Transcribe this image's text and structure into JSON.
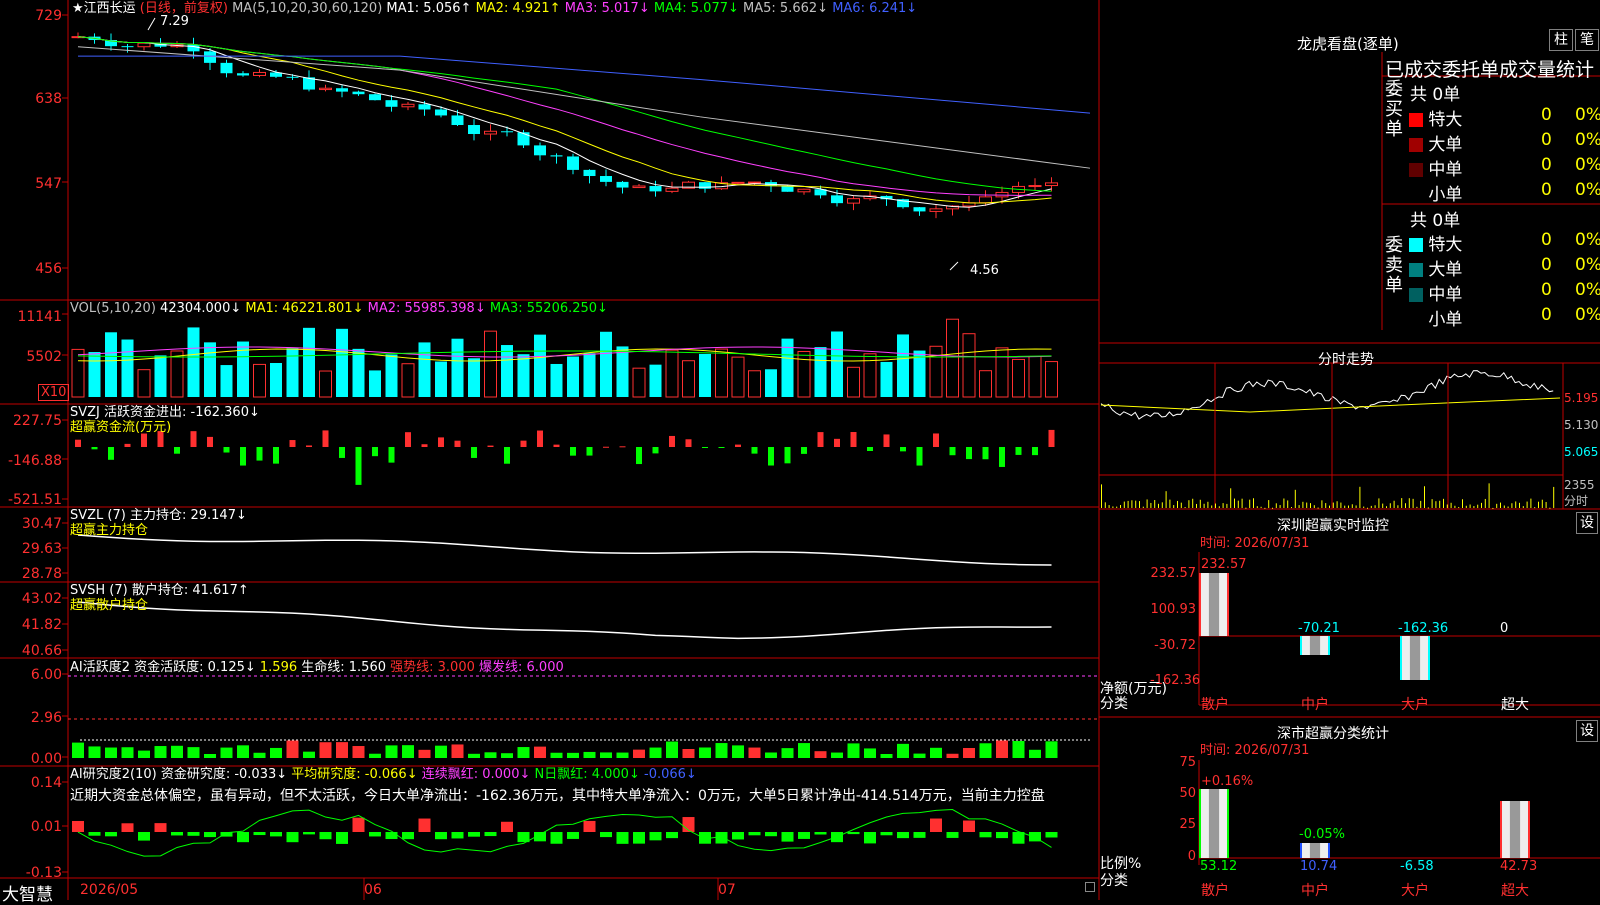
{
  "main": {
    "stock": "★江西长运",
    "period": "(日线，前复权)",
    "ma": {
      "label": "MA(5,10,20,30,60,120)",
      "ma1": "MA1: 5.056↑",
      "ma2": "MA2: 4.921↑",
      "ma3": "MA3: 5.017↓",
      "ma4": "MA4: 5.077↓",
      "ma5": "MA5: 5.662↓",
      "ma6": "MA6: 6.241↓"
    },
    "yticks": [
      "729",
      "638",
      "547",
      "456"
    ],
    "high_label": "7.29",
    "low_label": "4.56"
  },
  "vol": {
    "label": "VOL(5,10,20)",
    "value": "42304.000↓",
    "ma1": "MA1: 46221.801↓",
    "ma2": "MA2: 55985.398↓",
    "ma3": "MA3: 55206.250↓",
    "yticks": [
      "11141",
      "5502"
    ],
    "unit": "X10"
  },
  "svzj": {
    "label": "SVZJ  活跃资金进出: -162.360↓",
    "sub": "超赢资金流(万元)",
    "yticks": [
      "227.75",
      "-146.88",
      "-521.51"
    ]
  },
  "svzl": {
    "label": "SVZL (7) 主力持仓: 29.147↓",
    "sub": "超赢主力持仓",
    "yticks": [
      "30.47",
      "29.63",
      "28.78"
    ]
  },
  "svsh": {
    "label": "SVSH (7) 散户持仓: 41.617↑",
    "sub": "超赢散户持仓",
    "yticks": [
      "43.02",
      "41.82",
      "40.66"
    ]
  },
  "ai1": {
    "label": "AI活跃度2 资金活跃度: 0.125↓",
    "v2": "1.596",
    "life": "生命线: 1.560",
    "strong": "强势线: 3.000",
    "burst": "爆发线: 6.000",
    "yticks": [
      "6.00",
      "2.96",
      "0.00"
    ]
  },
  "ai2": {
    "label": "AI研究度2(10) 资金研究度: -0.033↓",
    "avg": "平均研究度: -0.066↓",
    "cont": "连续飘红: 0.000↓",
    "nday": "N日飘红: 4.000↓",
    "v5": "-0.066↓",
    "text": "近期大资金总体偏空，虽有异动，但不太活跃，今日大单净流出：-162.36万元，其中特大单净流入：0万元，大单5日累计净出-414.514万元，当前主力控盘",
    "yticks": [
      "0.14",
      "0.01",
      "-0.13"
    ]
  },
  "footer": {
    "brand": "大智慧",
    "dates": [
      "2026/05",
      "06",
      "07"
    ]
  },
  "lhb": {
    "title": "龙虎看盘(逐单)",
    "btn1": "柱",
    "btn2": "笔",
    "header": "已成交委托单成交量统计",
    "buy": {
      "side": "委买单",
      "total": "共 0单",
      "rows": [
        {
          "label": "特大",
          "count": "0",
          "pct": "0%"
        },
        {
          "label": "大单",
          "count": "0",
          "pct": "0%"
        },
        {
          "label": "中单",
          "count": "0",
          "pct": "0%"
        },
        {
          "label": "小单",
          "count": "0",
          "pct": "0%"
        }
      ]
    },
    "sell": {
      "side": "委卖单",
      "total": "共 0单",
      "rows": [
        {
          "label": "特大",
          "count": "0",
          "pct": "0%"
        },
        {
          "label": "大单",
          "count": "0",
          "pct": "0%"
        },
        {
          "label": "中单",
          "count": "0",
          "pct": "0%"
        },
        {
          "label": "小单",
          "count": "0",
          "pct": "0%"
        }
      ]
    }
  },
  "intraday": {
    "title": "分时走势",
    "prices": [
      "5.195",
      "5.130",
      "5.065"
    ],
    "vol": "2355",
    "vol_unit": "分时"
  },
  "monitor": {
    "title": "深圳超赢实时监控",
    "set": "设",
    "time": "时间: 2026/07/31",
    "yticks": [
      "232.57",
      "100.93",
      "-30.72",
      "-162.36"
    ],
    "ylabel": "净额(万元)",
    "xlabel": "分类",
    "categories": [
      "散户",
      "中户",
      "大户",
      "超大"
    ],
    "values": [
      "232.57",
      "-70.21",
      "-162.36",
      "0"
    ]
  },
  "classify": {
    "title": "深市超赢分类统计",
    "set": "设",
    "time": "时间: 2026/07/31",
    "yticks": [
      "75",
      "50",
      "25",
      "0"
    ],
    "ylabel": "比例%",
    "xlabel": "分类",
    "categories": [
      "散户",
      "中户",
      "大户",
      "超大"
    ],
    "top": [
      "+0.16%",
      "-0.05%",
      "",
      ""
    ],
    "values": [
      "53.12",
      "10.74",
      "-6.58",
      "42.73"
    ]
  },
  "colors": {
    "up": "#ff3030",
    "down": "#00ffff",
    "grid": "#c00000",
    "ma1": "#ffffff",
    "ma2": "#ffff00",
    "ma3": "#ff40ff",
    "ma4": "#00ff00",
    "ma5": "#c0c0c0",
    "ma6": "#4060ff"
  }
}
